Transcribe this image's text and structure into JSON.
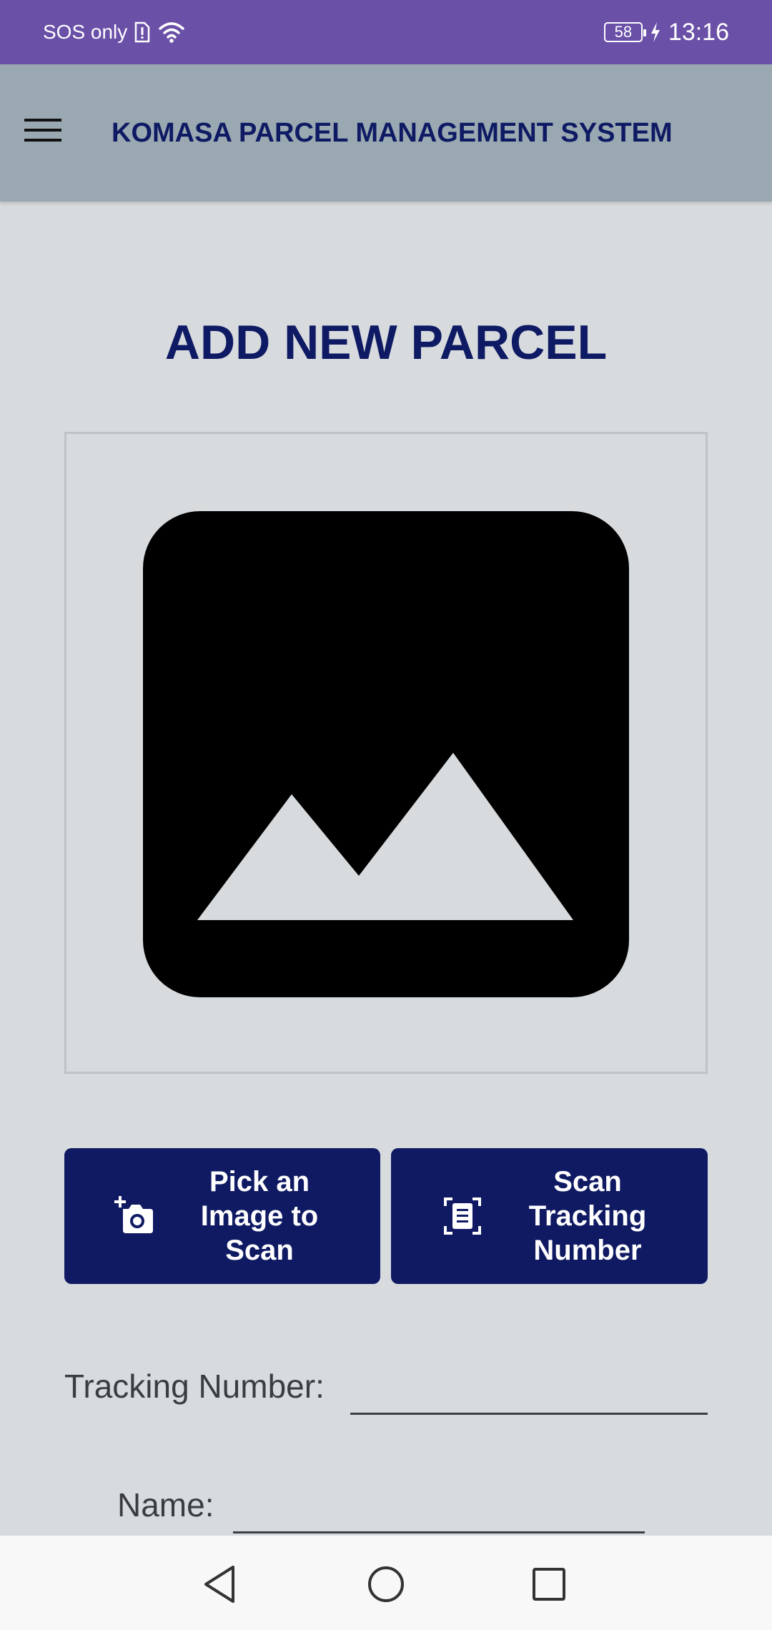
{
  "status_bar": {
    "carrier_text": "SOS only",
    "battery_level": "58",
    "time": "13:16"
  },
  "app_bar": {
    "title": "KOMASA PARCEL MANAGEMENT SYSTEM"
  },
  "page": {
    "title": "ADD NEW PARCEL"
  },
  "buttons": {
    "pick_image_label": "Pick an\nImage to\nScan",
    "scan_tracking_label": "Scan\nTracking\nNumber"
  },
  "form": {
    "tracking_number_label": "Tracking Number:",
    "tracking_number_value": "",
    "name_label": "Name:",
    "name_value": ""
  },
  "icons": {
    "menu": "hamburger-menu-icon",
    "placeholder": "image-placeholder-icon",
    "pick_image": "add-photo-camera-icon",
    "scan_tracking": "document-scanner-icon",
    "nav_back": "back-triangle-icon",
    "nav_home": "home-circle-icon",
    "nav_recents": "recents-square-icon"
  },
  "colors": {
    "status_bar": "#6a50a7",
    "app_bar": "#9aa8b1",
    "background": "#d8dbde",
    "accent_navy": "#0f1a63"
  }
}
